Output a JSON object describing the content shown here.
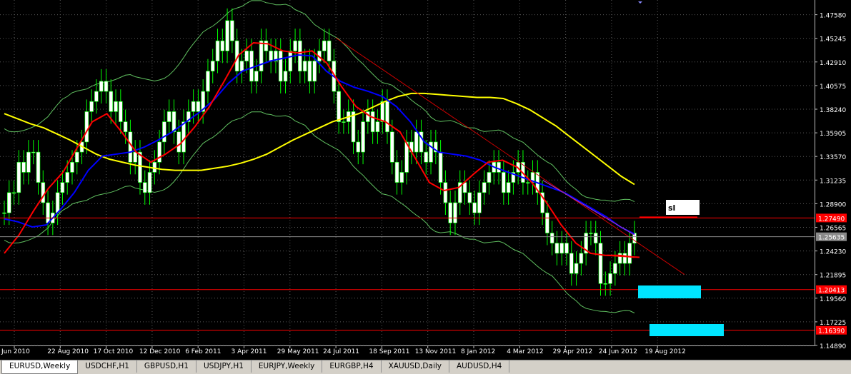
{
  "chart_data": {
    "type": "candlestick",
    "symbol_tab": "EURUSD,Weekly",
    "y_ticks": [
      "1.47580",
      "1.45245",
      "1.42910",
      "1.40575",
      "1.38240",
      "1.35905",
      "1.33570",
      "1.31235",
      "1.28900",
      "1.26565",
      "1.24230",
      "1.21895",
      "1.19560",
      "1.17225",
      "1.14890"
    ],
    "x_ticks": [
      "Jun 2010",
      "22 Aug 2010",
      "17 Oct 2010",
      "12 Dec 2010",
      "6 Feb 2011",
      "3 Apr 2011",
      "29 May 2011",
      "24 Jul 2011",
      "18 Sep 2011",
      "13 Nov 2011",
      "8 Jan 2012",
      "4 Mar 2012",
      "29 Apr 2012",
      "24 Jun 2012",
      "19 Aug 2012"
    ],
    "ylim": [
      1.1489,
      1.4875
    ],
    "current_price_label": "1.25635",
    "current_price": 1.25635,
    "hlines": [
      {
        "value": 1.2749,
        "label": "1.27490",
        "color": "#ff0000"
      },
      {
        "value": 1.2041,
        "label": "1.20413",
        "color": "#ff0000"
      },
      {
        "value": 1.1639,
        "label": "1.16390",
        "color": "#ff0000"
      }
    ],
    "annotation_text": "sl",
    "candle_color_up": "#ffffff",
    "candle_color_down": "#ffffff",
    "wick_color": "#00ff00",
    "closes": [
      1.28,
      1.3,
      1.3,
      1.33,
      1.32,
      1.34,
      1.34,
      1.31,
      1.29,
      1.27,
      1.28,
      1.3,
      1.31,
      1.32,
      1.33,
      1.34,
      1.35,
      1.38,
      1.39,
      1.4,
      1.41,
      1.4,
      1.38,
      1.39,
      1.37,
      1.36,
      1.33,
      1.34,
      1.31,
      1.3,
      1.32,
      1.33,
      1.35,
      1.37,
      1.38,
      1.36,
      1.34,
      1.37,
      1.38,
      1.39,
      1.38,
      1.4,
      1.42,
      1.43,
      1.45,
      1.44,
      1.47,
      1.45,
      1.42,
      1.43,
      1.44,
      1.41,
      1.42,
      1.45,
      1.44,
      1.43,
      1.44,
      1.41,
      1.42,
      1.44,
      1.45,
      1.42,
      1.43,
      1.41,
      1.43,
      1.44,
      1.45,
      1.43,
      1.4,
      1.37,
      1.37,
      1.38,
      1.35,
      1.34,
      1.37,
      1.38,
      1.36,
      1.37,
      1.39,
      1.36,
      1.33,
      1.31,
      1.32,
      1.35,
      1.34,
      1.36,
      1.34,
      1.33,
      1.35,
      1.34,
      1.31,
      1.29,
      1.27,
      1.29,
      1.31,
      1.3,
      1.29,
      1.28,
      1.3,
      1.31,
      1.32,
      1.33,
      1.32,
      1.3,
      1.31,
      1.32,
      1.33,
      1.31,
      1.31,
      1.32,
      1.3,
      1.28,
      1.26,
      1.25,
      1.24,
      1.25,
      1.24,
      1.22,
      1.23,
      1.24,
      1.26,
      1.26,
      1.25,
      1.21,
      1.21,
      1.22,
      1.23,
      1.24,
      1.23,
      1.25,
      1.26
    ],
    "series": [
      {
        "name": "",
        "color": "#ffff00",
        "values": [
          1.378,
          1.373,
          1.368,
          1.364,
          1.358,
          1.352,
          1.345,
          1.338,
          1.333,
          1.33,
          1.327,
          1.325,
          1.323,
          1.322,
          1.322,
          1.322,
          1.324,
          1.326,
          1.329,
          1.333,
          1.338,
          1.345,
          1.352,
          1.358,
          1.364,
          1.37,
          1.374,
          1.378,
          1.384,
          1.39,
          1.395,
          1.398,
          1.398,
          1.397,
          1.396,
          1.395,
          1.394,
          1.394,
          1.393,
          1.388,
          1.382,
          1.374,
          1.366,
          1.356,
          1.346,
          1.336,
          1.326,
          1.316,
          1.308
        ]
      },
      {
        "name": "",
        "color": "#0000ff",
        "values": [
          1.274,
          1.271,
          1.266,
          1.268,
          1.283,
          1.3,
          1.322,
          1.336,
          1.338,
          1.34,
          1.345,
          1.352,
          1.36,
          1.37,
          1.38,
          1.392,
          1.408,
          1.42,
          1.425,
          1.43,
          1.433,
          1.436,
          1.435,
          1.42,
          1.41,
          1.404,
          1.4,
          1.395,
          1.385,
          1.37,
          1.35,
          1.34,
          1.338,
          1.336,
          1.332,
          1.325,
          1.32,
          1.315,
          1.31,
          1.305,
          1.3,
          1.292,
          1.284,
          1.276,
          1.266,
          1.259
        ]
      },
      {
        "name": "",
        "color": "#ff0000",
        "values": [
          1.24,
          1.258,
          1.282,
          1.304,
          1.32,
          1.345,
          1.37,
          1.378,
          1.36,
          1.34,
          1.33,
          1.338,
          1.348,
          1.365,
          1.385,
          1.41,
          1.436,
          1.448,
          1.447,
          1.44,
          1.438,
          1.44,
          1.428,
          1.405,
          1.385,
          1.375,
          1.37,
          1.36,
          1.335,
          1.31,
          1.302,
          1.305,
          1.318,
          1.33,
          1.332,
          1.325,
          1.31,
          1.29,
          1.268,
          1.25,
          1.24,
          1.238,
          1.238,
          1.236
        ]
      }
    ]
  },
  "tabs": [
    "EURUSD,Weekly",
    "USDCHF,H1",
    "GBPUSD,H1",
    "USDJPY,H1",
    "EURJPY,Weekly",
    "EURGBP,H4",
    "XAUUSD,Daily",
    "AUDUSD,H4"
  ]
}
